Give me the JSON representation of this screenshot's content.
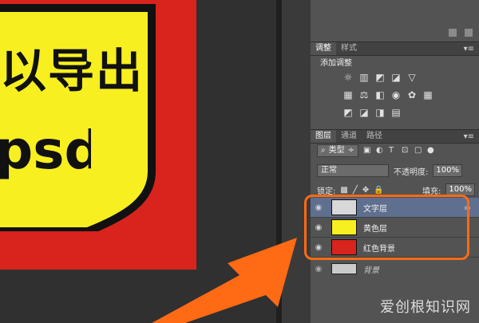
{
  "canvas": {
    "line1": "以导出",
    "line2": "psd",
    "colors": {
      "red": "#d9231d",
      "yellow": "#f7ef20",
      "arrow": "#ff6a14"
    }
  },
  "adjustments_panel": {
    "tabs": [
      "调整",
      "样式"
    ],
    "label": "添加调整",
    "icon_rows": [
      [
        "sun-icon",
        "levels-icon",
        "curves-icon",
        "exposure-icon",
        "triangle-icon"
      ],
      [
        "hsl-icon",
        "balance-icon",
        "bw-icon",
        "photo-filter-icon",
        "channel-mixer-icon",
        "color-lookup-icon"
      ],
      [
        "invert-icon",
        "posterize-icon",
        "threshold-icon",
        "gradient-map-icon"
      ]
    ]
  },
  "layers_panel": {
    "tabs": [
      "图层",
      "通道",
      "路径"
    ],
    "filter_label": "类型",
    "blend_mode": "正常",
    "opacity_label": "不透明度:",
    "opacity_value": "100%",
    "lock_label": "锁定:",
    "fill_label": "填充:",
    "fill_value": "100%",
    "layers": [
      {
        "name": "文字层",
        "thumb": "text-thumb",
        "active": true
      },
      {
        "name": "黄色层",
        "thumb": "yellow-thumb",
        "active": false
      },
      {
        "name": "红色背景",
        "thumb": "red-thumb",
        "active": false
      }
    ],
    "bottom_layer": "背景"
  },
  "watermark": "爱创根知识网"
}
